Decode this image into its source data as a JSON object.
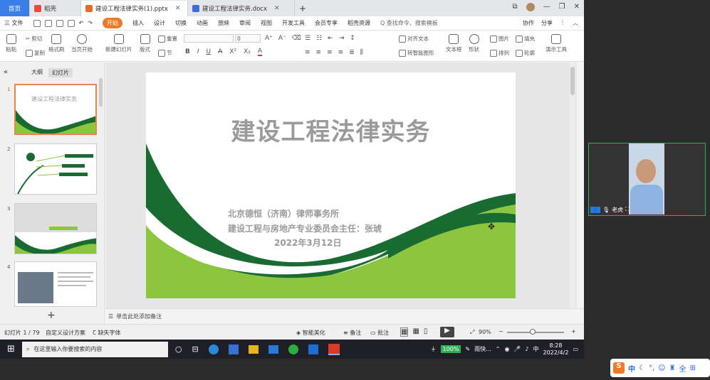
{
  "tabs": {
    "home": "首页",
    "tab1": "稻壳",
    "tab2": "建设工程法律实务(1).pptx",
    "tab3": "建设工程法律实务.docx",
    "add": "+"
  },
  "menu": {
    "file": "三 文件",
    "items": [
      "开始",
      "插入",
      "设计",
      "切换",
      "动画",
      "放映",
      "审阅",
      "视图",
      "开发工具",
      "会员专享",
      "稻壳资源"
    ],
    "search": "Q 查找命令、搜索模板",
    "collab": "协作",
    "share": "分享"
  },
  "ribbon": {
    "paste": "粘贴",
    "cut": "剪切",
    "copy": "复制",
    "format_painter": "格式刷",
    "from_start": "当页开始",
    "new_slide": "新建幻灯片",
    "layout": "版式",
    "section": "节",
    "reset": "重置",
    "align_text": "对齐文本",
    "to_smartart": "转智能图形",
    "textbox": "文本框",
    "shape": "形状",
    "arrange": "排列",
    "picture": "图片",
    "fill": "填充",
    "outline": "轮廓",
    "present_tool": "演示工具",
    "font_size": "0"
  },
  "leftpane": {
    "outline_tab": "大纲",
    "slides_tab": "幻灯片",
    "numbers": [
      "1",
      "2",
      "3",
      "4"
    ],
    "thumb1_title": "建设工程法律实务"
  },
  "slide": {
    "title": "建设工程法律实务",
    "line1": "北京德恒（济南）律师事务所",
    "line2": "建设工程与房地产专业委员会主任：张琥",
    "line3": "2022年3月12日"
  },
  "notes": {
    "placeholder": "单击此处添加备注"
  },
  "status": {
    "slide_count": "幻灯片 1 / 79",
    "design": "自定义设计方案",
    "missing_font": "缺失字体",
    "beautify": "智能美化",
    "notes": "备注",
    "comments": "批注",
    "zoom": "90%",
    "zoom_fraction": 0.45
  },
  "taskbar": {
    "search_placeholder": "在这里输入你要搜索的内容",
    "battery": "100%",
    "app_label": "雨快...",
    "time": "8:28",
    "date": "2022/4/2",
    "lang": "中"
  },
  "video": {
    "name": "老虎"
  },
  "ime": {
    "text": "中"
  },
  "colors": {
    "dark_green": "#1a6b32",
    "light_green": "#8cc63f",
    "accent_orange": "#f07a22",
    "home_blue": "#3a7ee8"
  }
}
